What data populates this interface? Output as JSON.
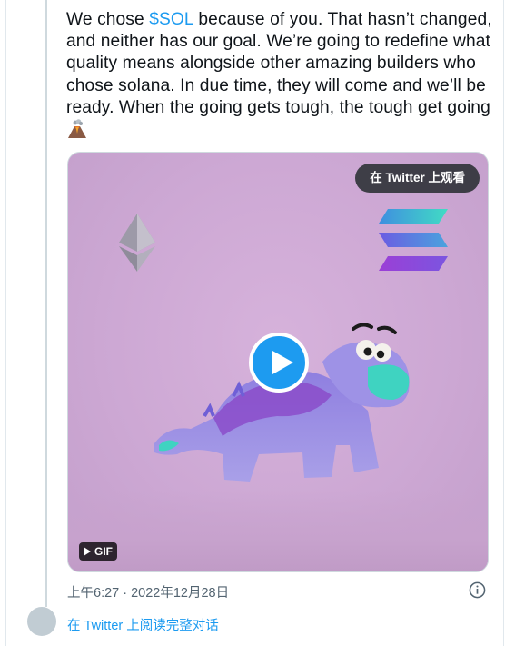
{
  "tweet": {
    "text_before_mention": "We chose ",
    "mention": "$SOL",
    "text_after_mention": " because of you. That hasn’t changed, and neither has our goal. We’re going to redefine what quality means alongside other amazing builders who chose solana. In due time, they will come and we’ll be ready. When the going gets tough, the tough get going ",
    "emoji": "volcano-emoji"
  },
  "media": {
    "watch_on_twitter_label": "在 Twitter 上观看",
    "gif_label": "GIF",
    "colors": {
      "background": "#cda8d4",
      "play_button": "#1d9bf0"
    }
  },
  "footer": {
    "timestamp": "上午6:27 · 2022年12月28日",
    "read_conversation_label": "在 Twitter 上阅读完整对话"
  },
  "colors": {
    "accent": "#1d9bf0",
    "text": "#0f1419",
    "muted": "#536471"
  }
}
